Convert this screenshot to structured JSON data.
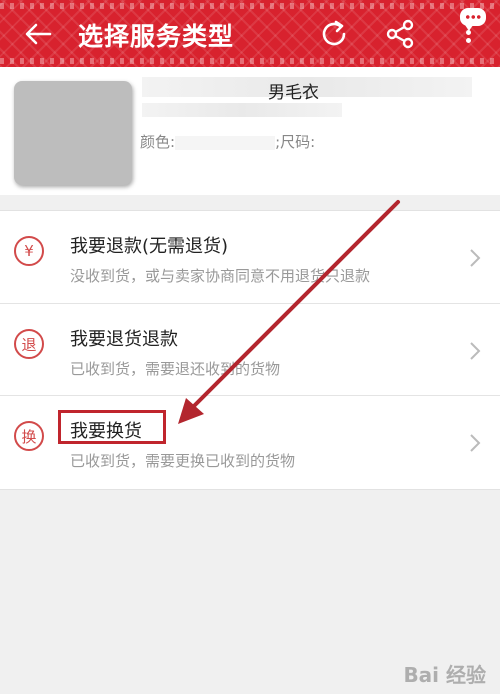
{
  "header": {
    "title": "选择服务类型",
    "bg_color": "#d8222e",
    "icons": [
      "back-arrow-icon",
      "refresh-icon",
      "share-icon",
      "chat-bubble-icon",
      "more-vertical-icon"
    ]
  },
  "product": {
    "name": "男毛衣",
    "color_label": "颜色:",
    "size_label": ";尺码:"
  },
  "options": [
    {
      "icon": "¥",
      "title": "我要退款(无需退货)",
      "desc": "没收到货，或与卖家协商同意不用退货只退款"
    },
    {
      "icon": "退",
      "title": "我要退货退款",
      "desc": "已收到货，需要退还收到的货物"
    },
    {
      "icon": "换",
      "title": "我要换货",
      "desc": "已收到货，需要更换已收到的货物"
    }
  ],
  "annotation": {
    "highlight_color": "#c0252d"
  },
  "watermark": "Bai 经验"
}
